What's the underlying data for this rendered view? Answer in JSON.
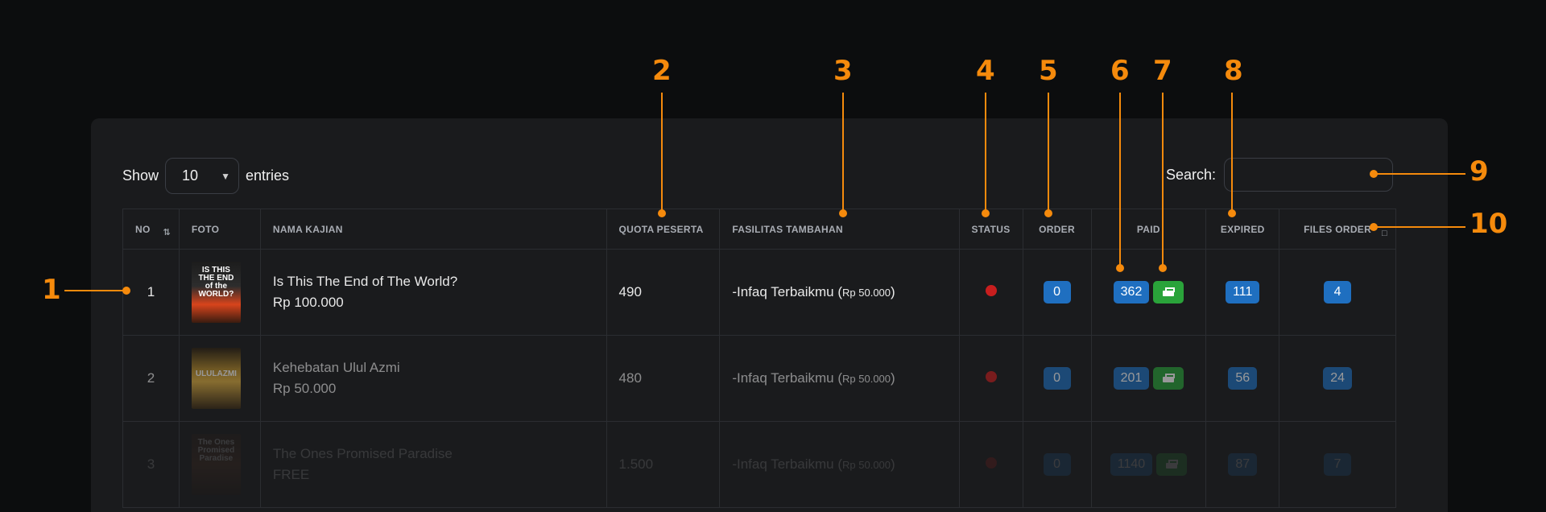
{
  "controls": {
    "show_label": "Show",
    "entries_value": "10",
    "entries_label": "entries",
    "search_label": "Search:",
    "search_value": ""
  },
  "table": {
    "headers": [
      "NO",
      "FOTO",
      "NAMA KAJIAN",
      "QUOTA PESERTA",
      "FASILITAS TAMBAHAN",
      "STATUS",
      "ORDER",
      "PAID",
      "EXPIRED",
      "FILES ORDER"
    ],
    "rows": [
      {
        "no": "1",
        "foto_text": "IS THIS THE END of the WORLD?",
        "nama": "Is This The End of The World?",
        "harga": "Rp 100.000",
        "quota": "490",
        "fasilitas": "-Infaq Terbaikmu (",
        "fasilitas_small": "Rp 50.000",
        "fasilitas_end": ")",
        "order": "0",
        "paid": "362",
        "expired": "111",
        "files": "4"
      },
      {
        "no": "2",
        "foto_text": "ULULAZMI",
        "nama": "Kehebatan Ulul Azmi",
        "harga": "Rp 50.000",
        "quota": "480",
        "fasilitas": "-Infaq Terbaikmu (",
        "fasilitas_small": "Rp 50.000",
        "fasilitas_end": ")",
        "order": "0",
        "paid": "201",
        "expired": "56",
        "files": "24"
      },
      {
        "no": "3",
        "foto_text": "The Ones Promised Paradise",
        "nama": "The Ones Promised Paradise",
        "harga": "FREE",
        "quota": "1.500",
        "fasilitas": "-Infaq Terbaikmu (",
        "fasilitas_small": "Rp 50.000",
        "fasilitas_end": ")",
        "order": "0",
        "paid": "1140",
        "expired": "87",
        "files": "7"
      }
    ]
  },
  "callouts": [
    "1",
    "2",
    "3",
    "4",
    "5",
    "6",
    "7",
    "8",
    "9",
    "10"
  ],
  "colors": {
    "accent": "#f58a0c",
    "badge_blue": "#1f6fc0",
    "badge_green": "#2aa33a",
    "status_red": "#c81e1e"
  },
  "icons": [
    "sort-icon",
    "print-icon",
    "chevron-down-icon"
  ]
}
